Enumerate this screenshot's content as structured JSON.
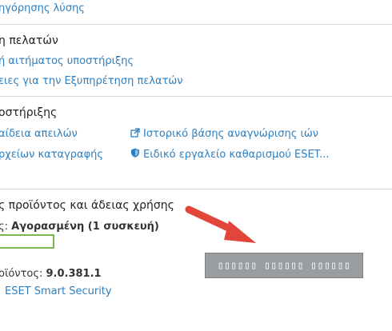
{
  "top_link": "ηγόρησης λύσης",
  "customer_section": {
    "heading": "η πελατών",
    "links": [
      "ή αιτήματος υποστήριξης",
      "ειες για την Εξυπηρέτηση πελατών"
    ]
  },
  "support_section": {
    "heading": "οστήριξης",
    "links_left": [
      "αίδεια απειλών",
      "ρχείων καταγραφής"
    ],
    "links_right": [
      "Ιστορικό βάσης αναγνώρισης ιών",
      "Ειδικό εργαλείο καθαρισμού ESET..."
    ],
    "icons": [
      "external-link-icon",
      "shield-icon"
    ]
  },
  "product_section": {
    "heading": "ς προϊόντος και άδειας χρήσης",
    "license_label": "ς:",
    "license_value": "Αγορασμένη (1 συσκευή)",
    "version_label": "οϊόντος:",
    "version_value": "9.0.381.1",
    "product_link": "ESET Smart Security"
  },
  "redacted_box_text": "▯▯▯▯▯▯ ▯▯▯▯▯▯ ▯▯▯▯▯▯",
  "colors": {
    "link": "#2d7fc1",
    "arrow": "#e2463a",
    "highlight_border": "#7ab648",
    "redact_box": "#9a9ea1"
  }
}
